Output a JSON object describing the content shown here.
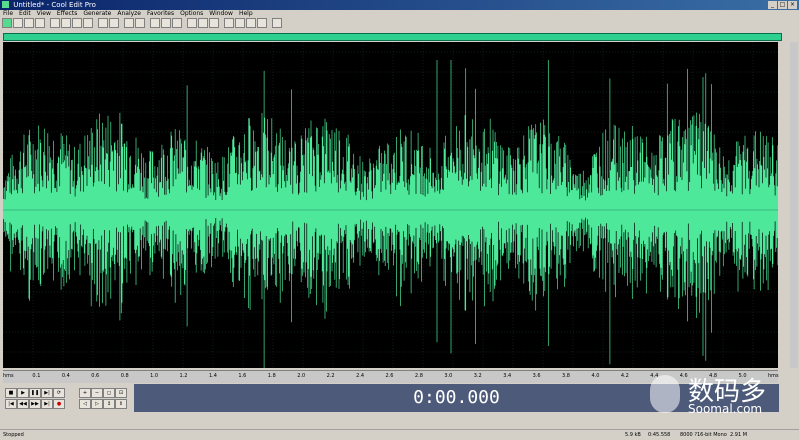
{
  "window": {
    "title": "Untitled* - Cool Edit Pro",
    "controls": [
      "_",
      "□",
      "×"
    ]
  },
  "menu": [
    "File",
    "Edit",
    "View",
    "Effects",
    "Generate",
    "Analyze",
    "Favorites",
    "Options",
    "Window",
    "Help"
  ],
  "time_display": "0:00.000",
  "ruler_labels": [
    "hms",
    "0.1",
    "0.4",
    "0.6",
    "0.8",
    "1.0",
    "1.2",
    "1.4",
    "1.6",
    "1.8",
    "2.0",
    "2.2",
    "2.4",
    "2.6",
    "2.8",
    "3.0",
    "3.2",
    "3.4",
    "3.6",
    "3.8",
    "4.0",
    "4.2",
    "4.4",
    "4.6",
    "4.8",
    "5.0",
    "hms"
  ],
  "status": {
    "state": "Stopped",
    "rate": "5.9 kB",
    "length": "0:45.558",
    "format": "8000 ?16-bit Mono",
    "disk": "2.91 M"
  },
  "watermark": {
    "text": "数码多",
    "url": "Soomal.com"
  },
  "colors": {
    "waveform": "#4de89a",
    "wave_bg": "#000000",
    "grid": "#1c3a3a",
    "time_bg": "#4d5a7a"
  }
}
